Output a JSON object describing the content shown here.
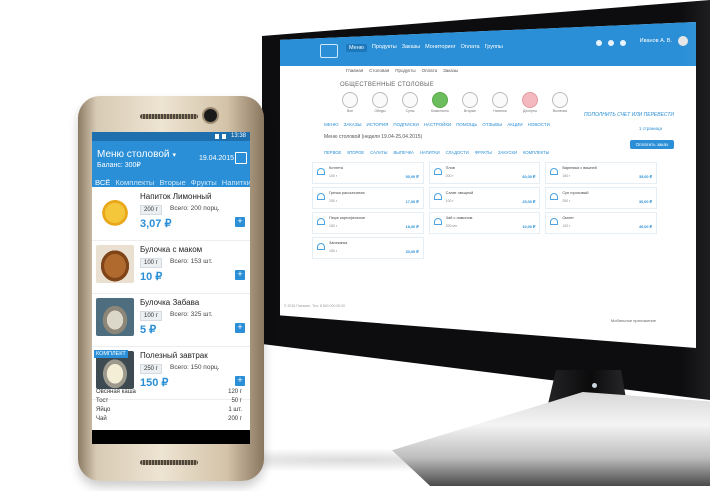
{
  "monitor": {
    "nav": [
      "Меню",
      "Продукты",
      "Заказы",
      "Мониторинг",
      "Оплата",
      "Группы"
    ],
    "nav_active_index": 0,
    "user": "Иванов А. В.",
    "subnav": [
      "Главная",
      "Столовая",
      "Продукты",
      "Оплата",
      "Заказы"
    ],
    "canteen_title": "ОБЩЕСТВЕННЫЕ СТОЛОВЫЕ",
    "categories": [
      {
        "label": "Все",
        "color": "plain"
      },
      {
        "label": "Обеды",
        "color": "plain"
      },
      {
        "label": "Супы",
        "color": "plain"
      },
      {
        "label": "Комплекты",
        "color": "green"
      },
      {
        "label": "Вторые",
        "color": "plain"
      },
      {
        "label": "Напитки",
        "color": "plain"
      },
      {
        "label": "Десерты",
        "color": "pink"
      },
      {
        "label": "Выпечка",
        "color": "plain"
      }
    ],
    "topup_link": "ПОПОЛНИТЬ СЧЕТ ИЛИ ПЕРЕВЕСТИ",
    "tabs": [
      "МЕНЮ",
      "ЗАКАЗЫ",
      "ИСТОРИЯ",
      "ПОДПИСКИ",
      "НАСТРОЙКИ",
      "ПОМОЩЬ",
      "ОТЗЫВЫ",
      "АКЦИИ",
      "НОВОСТИ"
    ],
    "pagination": "1 страница",
    "menu_title": "Меню столовой (неделя 19.04-25.04.2015)",
    "pay_button": "Оплатить заказ",
    "filters": [
      "ПЕРВОЕ",
      "ВТОРОЕ",
      "САЛАТЫ",
      "ВЫПЕЧКА",
      "НАПИТКИ",
      "СЛАДОСТИ",
      "ФРУКТЫ",
      "ЗАКУСКИ",
      "КОМПЛЕКТЫ"
    ],
    "items": [
      {
        "name": "Котлета",
        "weight": "100 г",
        "price": "50,00 ₽"
      },
      {
        "name": "Плов",
        "weight": "200 г",
        "price": "60,00 ₽"
      },
      {
        "name": "Вареники с вишней",
        "weight": "150 г",
        "price": "35,00 ₽"
      },
      {
        "name": "Гречка рассыпчатая",
        "weight": "150 г",
        "price": "17,00 ₽"
      },
      {
        "name": "Салат овощной",
        "weight": "100 г",
        "price": "25,00 ₽"
      },
      {
        "name": "Суп гороховый",
        "weight": "250 г",
        "price": "30,00 ₽"
      },
      {
        "name": "Пюре картофельное",
        "weight": "150 г",
        "price": "18,00 ₽"
      },
      {
        "name": "Чай с лимоном",
        "weight": "200 мл",
        "price": "10,00 ₽"
      },
      {
        "name": "Омлет",
        "weight": "120 г",
        "price": "40,00 ₽"
      },
      {
        "name": "Запеканка",
        "weight": "150 г",
        "price": "33,00 ₽"
      }
    ],
    "footer_left": "© 2015 Питание. Тел: 8 800 000 00 00",
    "footer_right": "Мобильное приложение"
  },
  "phone": {
    "status_time": "13:38",
    "title": "Меню столовой",
    "title_caret": "▾",
    "balance": "Баланс: 300₽",
    "date": "19.04.2015",
    "tabs": [
      "ВСЁ",
      "Комплекты",
      "Вторые",
      "Фрукты",
      "Напитки"
    ],
    "items": [
      {
        "name": "Напиток Лимонный",
        "weight": "200 г",
        "total": "Всего: 200 порц.",
        "price": "3,07 ₽",
        "img": "img-lemonade"
      },
      {
        "name": "Булочка с маком",
        "weight": "100 г",
        "total": "Всего: 153 шт.",
        "price": "10 ₽",
        "img": "img-bun1"
      },
      {
        "name": "Булочка Забава",
        "weight": "100 г",
        "total": "Всего: 325 шт.",
        "price": "5 ₽",
        "img": "img-bun2"
      },
      {
        "name": "Полезный завтрак",
        "weight": "250 г",
        "total": "Всего: 150 порц.",
        "price": "150 ₽",
        "img": "img-breakfast",
        "badge": "КОМПЛЕКТ"
      }
    ],
    "components": [
      {
        "name": "Овсяная каша",
        "weight": "120 г"
      },
      {
        "name": "Тост",
        "weight": "50 г"
      },
      {
        "name": "Яйцо",
        "weight": "1 шт."
      },
      {
        "name": "Чай",
        "weight": "200 г"
      }
    ],
    "add_label": "+"
  },
  "colors": {
    "accent": "#2a8fd6",
    "accent_dark": "#1d6fae"
  }
}
